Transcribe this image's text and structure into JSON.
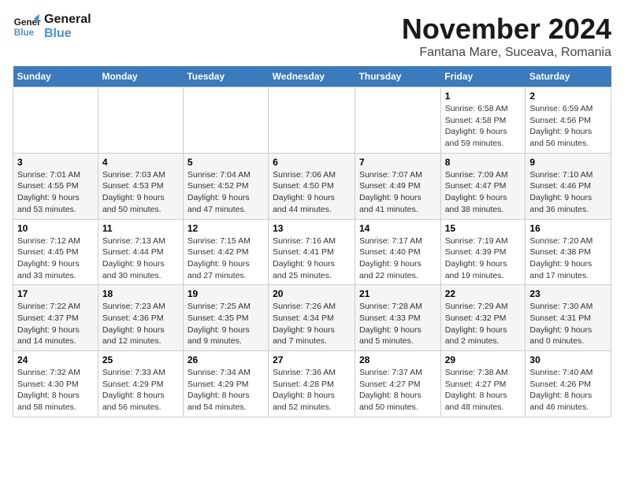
{
  "logo": {
    "line1": "General",
    "line2": "Blue"
  },
  "title": "November 2024",
  "location": "Fantana Mare, Suceava, Romania",
  "days_of_week": [
    "Sunday",
    "Monday",
    "Tuesday",
    "Wednesday",
    "Thursday",
    "Friday",
    "Saturday"
  ],
  "weeks": [
    [
      {
        "day": "",
        "info": ""
      },
      {
        "day": "",
        "info": ""
      },
      {
        "day": "",
        "info": ""
      },
      {
        "day": "",
        "info": ""
      },
      {
        "day": "",
        "info": ""
      },
      {
        "day": "1",
        "info": "Sunrise: 6:58 AM\nSunset: 4:58 PM\nDaylight: 9 hours and 59 minutes."
      },
      {
        "day": "2",
        "info": "Sunrise: 6:59 AM\nSunset: 4:56 PM\nDaylight: 9 hours and 56 minutes."
      }
    ],
    [
      {
        "day": "3",
        "info": "Sunrise: 7:01 AM\nSunset: 4:55 PM\nDaylight: 9 hours and 53 minutes."
      },
      {
        "day": "4",
        "info": "Sunrise: 7:03 AM\nSunset: 4:53 PM\nDaylight: 9 hours and 50 minutes."
      },
      {
        "day": "5",
        "info": "Sunrise: 7:04 AM\nSunset: 4:52 PM\nDaylight: 9 hours and 47 minutes."
      },
      {
        "day": "6",
        "info": "Sunrise: 7:06 AM\nSunset: 4:50 PM\nDaylight: 9 hours and 44 minutes."
      },
      {
        "day": "7",
        "info": "Sunrise: 7:07 AM\nSunset: 4:49 PM\nDaylight: 9 hours and 41 minutes."
      },
      {
        "day": "8",
        "info": "Sunrise: 7:09 AM\nSunset: 4:47 PM\nDaylight: 9 hours and 38 minutes."
      },
      {
        "day": "9",
        "info": "Sunrise: 7:10 AM\nSunset: 4:46 PM\nDaylight: 9 hours and 36 minutes."
      }
    ],
    [
      {
        "day": "10",
        "info": "Sunrise: 7:12 AM\nSunset: 4:45 PM\nDaylight: 9 hours and 33 minutes."
      },
      {
        "day": "11",
        "info": "Sunrise: 7:13 AM\nSunset: 4:44 PM\nDaylight: 9 hours and 30 minutes."
      },
      {
        "day": "12",
        "info": "Sunrise: 7:15 AM\nSunset: 4:42 PM\nDaylight: 9 hours and 27 minutes."
      },
      {
        "day": "13",
        "info": "Sunrise: 7:16 AM\nSunset: 4:41 PM\nDaylight: 9 hours and 25 minutes."
      },
      {
        "day": "14",
        "info": "Sunrise: 7:17 AM\nSunset: 4:40 PM\nDaylight: 9 hours and 22 minutes."
      },
      {
        "day": "15",
        "info": "Sunrise: 7:19 AM\nSunset: 4:39 PM\nDaylight: 9 hours and 19 minutes."
      },
      {
        "day": "16",
        "info": "Sunrise: 7:20 AM\nSunset: 4:38 PM\nDaylight: 9 hours and 17 minutes."
      }
    ],
    [
      {
        "day": "17",
        "info": "Sunrise: 7:22 AM\nSunset: 4:37 PM\nDaylight: 9 hours and 14 minutes."
      },
      {
        "day": "18",
        "info": "Sunrise: 7:23 AM\nSunset: 4:36 PM\nDaylight: 9 hours and 12 minutes."
      },
      {
        "day": "19",
        "info": "Sunrise: 7:25 AM\nSunset: 4:35 PM\nDaylight: 9 hours and 9 minutes."
      },
      {
        "day": "20",
        "info": "Sunrise: 7:26 AM\nSunset: 4:34 PM\nDaylight: 9 hours and 7 minutes."
      },
      {
        "day": "21",
        "info": "Sunrise: 7:28 AM\nSunset: 4:33 PM\nDaylight: 9 hours and 5 minutes."
      },
      {
        "day": "22",
        "info": "Sunrise: 7:29 AM\nSunset: 4:32 PM\nDaylight: 9 hours and 2 minutes."
      },
      {
        "day": "23",
        "info": "Sunrise: 7:30 AM\nSunset: 4:31 PM\nDaylight: 9 hours and 0 minutes."
      }
    ],
    [
      {
        "day": "24",
        "info": "Sunrise: 7:32 AM\nSunset: 4:30 PM\nDaylight: 8 hours and 58 minutes."
      },
      {
        "day": "25",
        "info": "Sunrise: 7:33 AM\nSunset: 4:29 PM\nDaylight: 8 hours and 56 minutes."
      },
      {
        "day": "26",
        "info": "Sunrise: 7:34 AM\nSunset: 4:29 PM\nDaylight: 8 hours and 54 minutes."
      },
      {
        "day": "27",
        "info": "Sunrise: 7:36 AM\nSunset: 4:28 PM\nDaylight: 8 hours and 52 minutes."
      },
      {
        "day": "28",
        "info": "Sunrise: 7:37 AM\nSunset: 4:27 PM\nDaylight: 8 hours and 50 minutes."
      },
      {
        "day": "29",
        "info": "Sunrise: 7:38 AM\nSunset: 4:27 PM\nDaylight: 8 hours and 48 minutes."
      },
      {
        "day": "30",
        "info": "Sunrise: 7:40 AM\nSunset: 4:26 PM\nDaylight: 8 hours and 46 minutes."
      }
    ]
  ]
}
